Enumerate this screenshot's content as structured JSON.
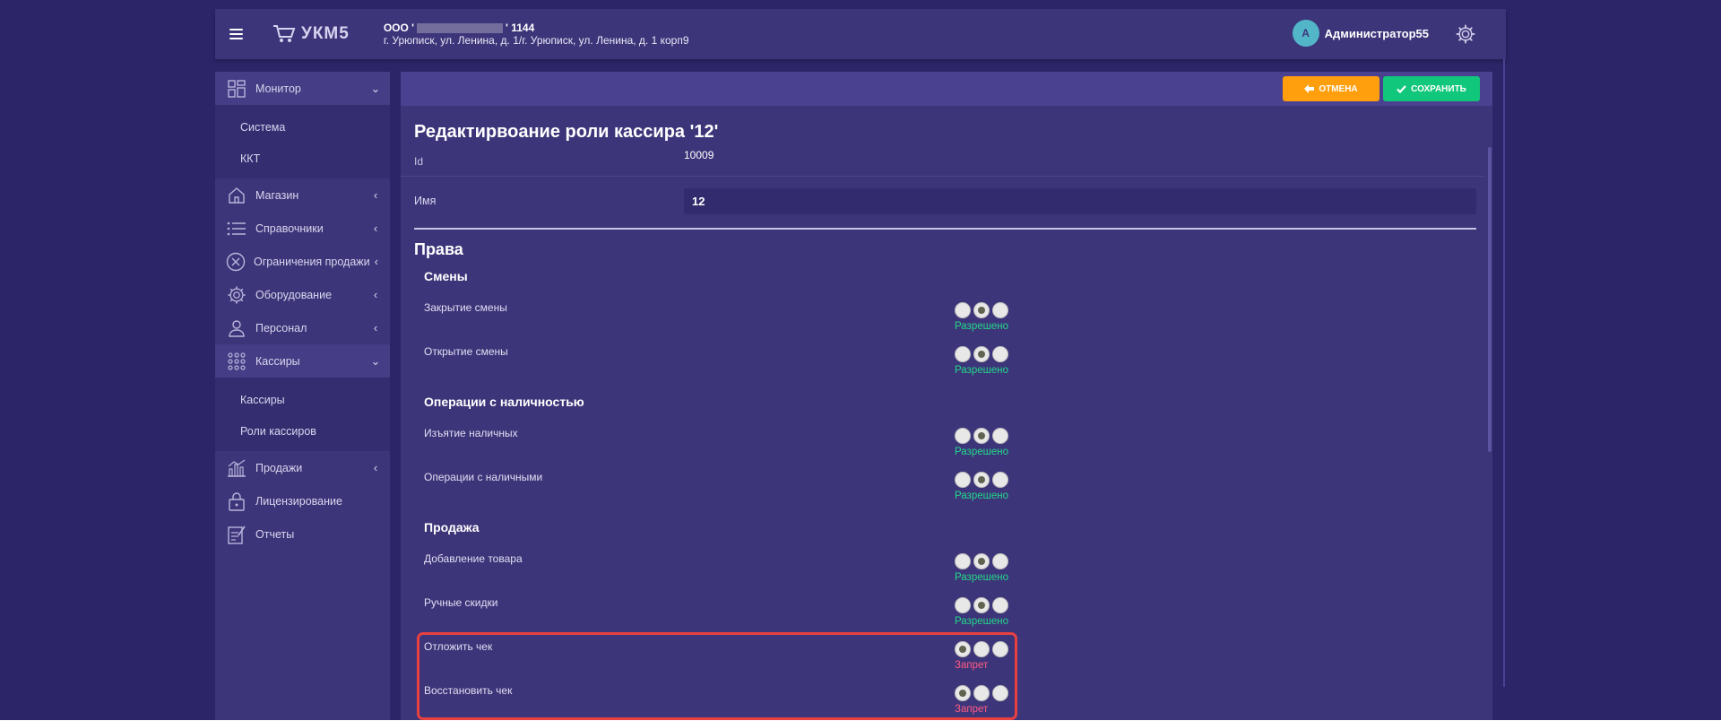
{
  "header": {
    "logo_text": "УКМ5",
    "org_prefix": "ООО '",
    "org_suffix": "' 1144",
    "address": "г. Урюписк, ул. Ленина, д. 1/г. Урюписк, ул. Ленина, д. 1 корп9",
    "avatar_letter": "А",
    "user_name": "Администратор55"
  },
  "sidebar": {
    "items": [
      {
        "label": "Монитор",
        "icon": "grid-icon",
        "caret": "down"
      },
      {
        "label": "Магазин",
        "icon": "house-icon",
        "caret": "left"
      },
      {
        "label": "Справочники",
        "icon": "list-icon",
        "caret": "left"
      },
      {
        "label": "Ограничения продажи",
        "icon": "cross-circle-icon",
        "caret": "left"
      },
      {
        "label": "Оборудование",
        "icon": "gear-icon",
        "caret": "left"
      },
      {
        "label": "Персонал",
        "icon": "person-icon",
        "caret": "left"
      },
      {
        "label": "Кассиры",
        "icon": "dots-grid-icon",
        "caret": "down"
      },
      {
        "label": "Продажи",
        "icon": "bar-chart-icon",
        "caret": "left"
      },
      {
        "label": "Лицензирование",
        "icon": "lock-icon",
        "caret": ""
      },
      {
        "label": "Отчеты",
        "icon": "report-icon",
        "caret": ""
      }
    ],
    "monitor_sub": [
      "Система",
      "ККТ"
    ],
    "cashiers_sub": [
      "Кассиры",
      "Роли кассиров"
    ]
  },
  "toolbar": {
    "cancel_label": "ОТМЕНА",
    "save_label": "СОХРАНИТЬ"
  },
  "form": {
    "title": "Редактирвоание роли кассира '12'",
    "id_label": "Id",
    "id_value": "10009",
    "name_label": "Имя",
    "name_value": "12"
  },
  "rights": {
    "title": "Права",
    "groups": [
      {
        "title": "Смены",
        "items": [
          {
            "label": "Закрытие смены",
            "selected": 1,
            "status": "Разрешено"
          },
          {
            "label": "Открытие смены",
            "selected": 1,
            "status": "Разрешено"
          }
        ]
      },
      {
        "title": "Операции с наличностью",
        "items": [
          {
            "label": "Изъятие наличных",
            "selected": 1,
            "status": "Разрешено"
          },
          {
            "label": "Операции с наличными",
            "selected": 1,
            "status": "Разрешено"
          }
        ]
      },
      {
        "title": "Продажа",
        "items": [
          {
            "label": "Добавление товара",
            "selected": 1,
            "status": "Разрешено"
          },
          {
            "label": "Ручные скидки",
            "selected": 1,
            "status": "Разрешено"
          },
          {
            "label": "Отложить чек",
            "selected": 0,
            "status": "Запрет"
          },
          {
            "label": "Восстановить чек",
            "selected": 0,
            "status": "Запрет"
          }
        ]
      }
    ]
  },
  "colors": {
    "background": "#2c2568",
    "panel": "#3d3579",
    "cancel": "#ff9f0e",
    "save": "#11c77b",
    "allowed": "#22d98a",
    "denied": "#ff5a83",
    "highlight": "#e84040"
  }
}
